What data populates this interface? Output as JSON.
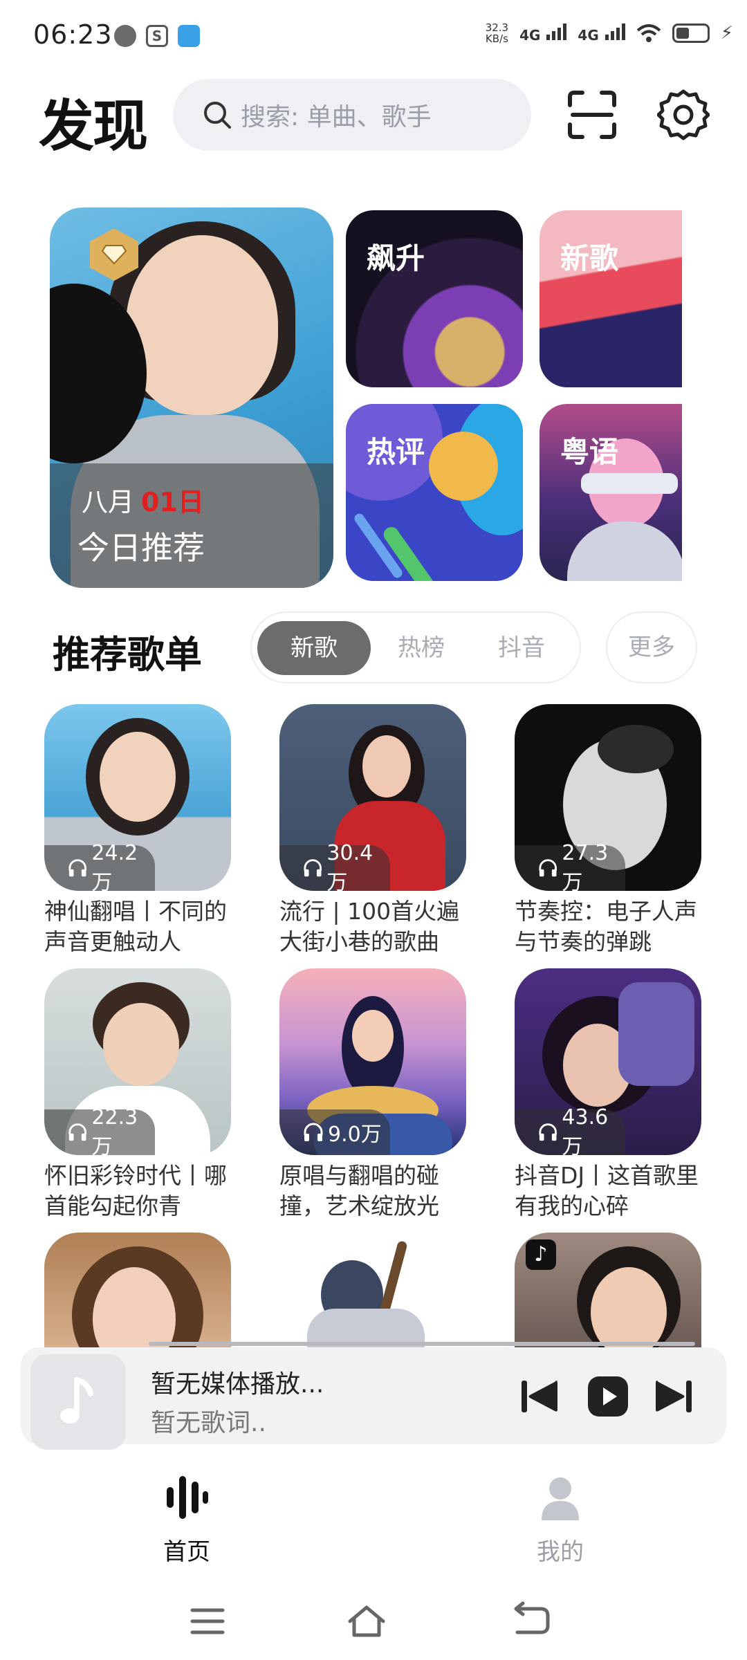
{
  "status_bar": {
    "time": "06:23",
    "net_speed_value": "32.3",
    "net_speed_unit": "KB/s",
    "signal_1": "4G",
    "signal_2": "4G"
  },
  "header": {
    "title": "发现",
    "search_placeholder": "搜索: 单曲、歌手"
  },
  "banner": {
    "feature": {
      "month": "八月",
      "day": "01日",
      "title": "今日推荐"
    },
    "tiles": [
      "飙升",
      "新歌",
      "热评",
      "粤语"
    ]
  },
  "playlist_section": {
    "title": "推荐歌单",
    "tabs": [
      "新歌",
      "热榜",
      "抖音"
    ],
    "active_tab": "新歌",
    "more_label": "更多"
  },
  "playlists": [
    {
      "plays": "24.2万",
      "title": "神仙翻唱丨不同的声音更触动人"
    },
    {
      "plays": "30.4万",
      "title": "流行 | 100首火遍大街小巷的歌曲"
    },
    {
      "plays": "27.3万",
      "title": "节奏控：电子人声与节奏的弹跳"
    },
    {
      "plays": "22.3万",
      "title": "怀旧彩铃时代丨哪首能勾起你青"
    },
    {
      "plays": "9.0万",
      "title": "原唱与翻唱的碰撞，艺术绽放光"
    },
    {
      "plays": "43.6万",
      "title": "抖音DJ丨这首歌里有我的心碎"
    }
  ],
  "player": {
    "title": "暂无媒体播放...",
    "lyric": "暂无歌词.."
  },
  "bottom_nav": {
    "home": "首页",
    "mine": "我的"
  },
  "colors": {
    "accent_red": "#e02020",
    "tab_active_bg": "#6c6c6c",
    "search_bg": "#eef0f4"
  }
}
